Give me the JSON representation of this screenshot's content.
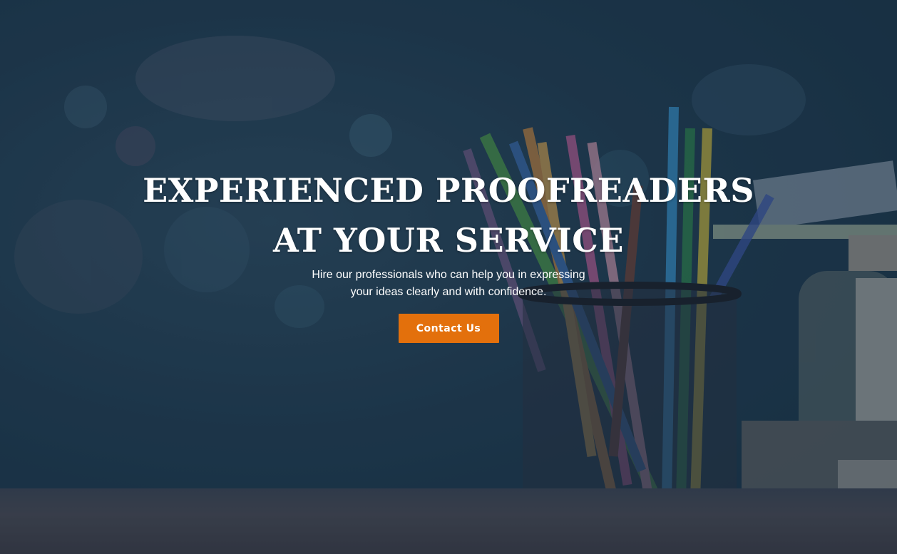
{
  "hero": {
    "headline_line1": "EXPERIENCED PROOFREADERS",
    "headline_line2": "AT YOUR SERVICE",
    "subtitle_line1": "Hire our professionals who can help you in expressing",
    "subtitle_line2": "your ideas clearly and with confidence.",
    "cta_label": "Contact Us"
  },
  "colors": {
    "background": "#1f3a4e",
    "accent": "#e3700c",
    "text": "#ffffff"
  },
  "background_image": {
    "subject": "pencils-in-mesh-cup-with-books-on-desk"
  }
}
